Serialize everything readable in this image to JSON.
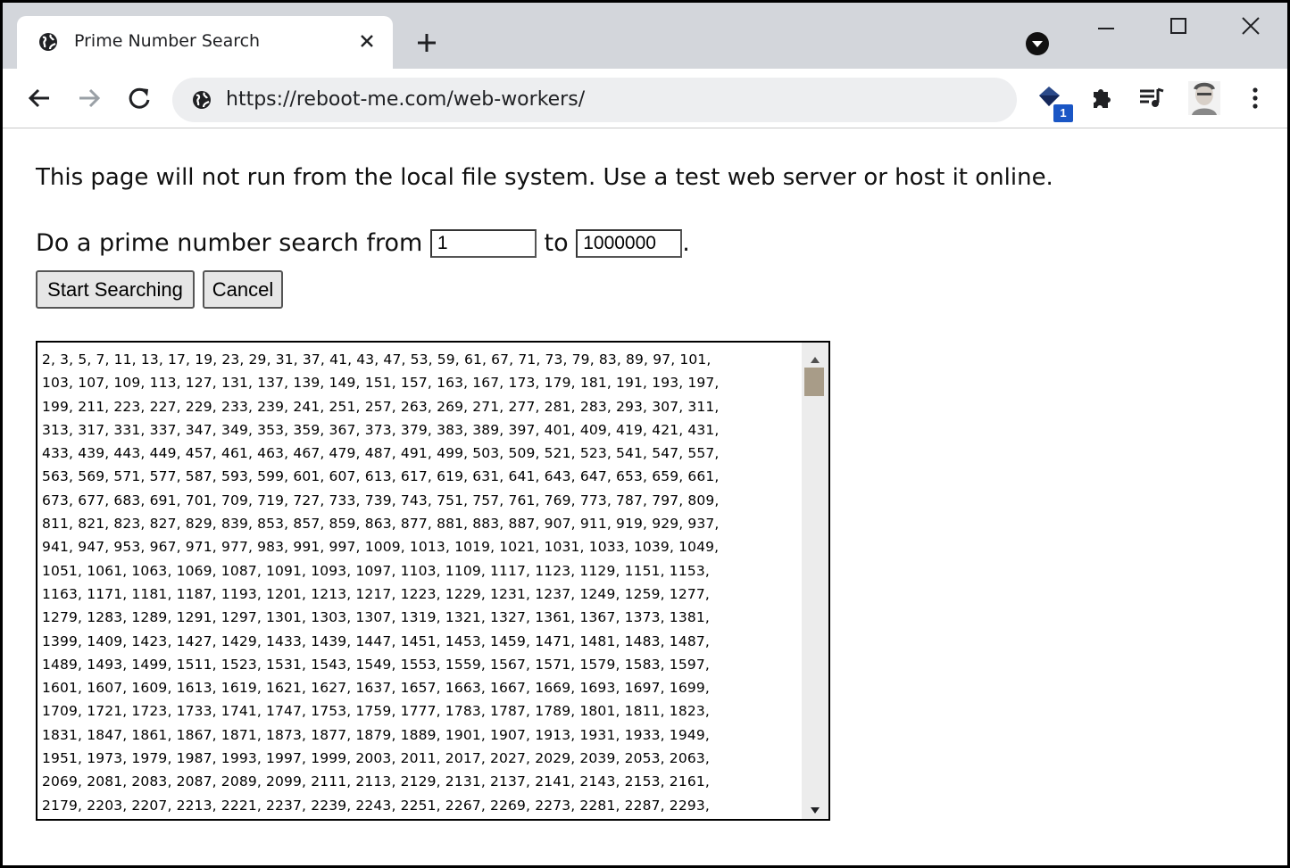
{
  "browser": {
    "tab_title": "Prime Number Search",
    "url": "https://reboot-me.com/web-workers/",
    "extension_badge": "1"
  },
  "page": {
    "notice": "This page will not run from the local file system. Use a test web server or host it online.",
    "search_prefix": "Do a prime number search from",
    "search_to": "to",
    "search_suffix": ".",
    "from_value": "1",
    "to_value": "1000000",
    "start_button": "Start Searching",
    "cancel_button": "Cancel"
  },
  "results": {
    "lines": [
      "2, 3, 5, 7, 11, 13, 17, 19, 23, 29, 31, 37, 41, 43, 47, 53, 59, 61, 67, 71, 73, 79, 83, 89, 97, 101,",
      "103, 107, 109, 113, 127, 131, 137, 139, 149, 151, 157, 163, 167, 173, 179, 181, 191, 193, 197,",
      "199, 211, 223, 227, 229, 233, 239, 241, 251, 257, 263, 269, 271, 277, 281, 283, 293, 307, 311,",
      "313, 317, 331, 337, 347, 349, 353, 359, 367, 373, 379, 383, 389, 397, 401, 409, 419, 421, 431,",
      "433, 439, 443, 449, 457, 461, 463, 467, 479, 487, 491, 499, 503, 509, 521, 523, 541, 547, 557,",
      "563, 569, 571, 577, 587, 593, 599, 601, 607, 613, 617, 619, 631, 641, 643, 647, 653, 659, 661,",
      "673, 677, 683, 691, 701, 709, 719, 727, 733, 739, 743, 751, 757, 761, 769, 773, 787, 797, 809,",
      "811, 821, 823, 827, 829, 839, 853, 857, 859, 863, 877, 881, 883, 887, 907, 911, 919, 929, 937,",
      "941, 947, 953, 967, 971, 977, 983, 991, 997, 1009, 1013, 1019, 1021, 1031, 1033, 1039, 1049,",
      "1051, 1061, 1063, 1069, 1087, 1091, 1093, 1097, 1103, 1109, 1117, 1123, 1129, 1151, 1153,",
      "1163, 1171, 1181, 1187, 1193, 1201, 1213, 1217, 1223, 1229, 1231, 1237, 1249, 1259, 1277,",
      "1279, 1283, 1289, 1291, 1297, 1301, 1303, 1307, 1319, 1321, 1327, 1361, 1367, 1373, 1381,",
      "1399, 1409, 1423, 1427, 1429, 1433, 1439, 1447, 1451, 1453, 1459, 1471, 1481, 1483, 1487,",
      "1489, 1493, 1499, 1511, 1523, 1531, 1543, 1549, 1553, 1559, 1567, 1571, 1579, 1583, 1597,",
      "1601, 1607, 1609, 1613, 1619, 1621, 1627, 1637, 1657, 1663, 1667, 1669, 1693, 1697, 1699,",
      "1709, 1721, 1723, 1733, 1741, 1747, 1753, 1759, 1777, 1783, 1787, 1789, 1801, 1811, 1823,",
      "1831, 1847, 1861, 1867, 1871, 1873, 1877, 1879, 1889, 1901, 1907, 1913, 1931, 1933, 1949,",
      "1951, 1973, 1979, 1987, 1993, 1997, 1999, 2003, 2011, 2017, 2027, 2029, 2039, 2053, 2063,",
      "2069, 2081, 2083, 2087, 2089, 2099, 2111, 2113, 2129, 2131, 2137, 2141, 2143, 2153, 2161,",
      "2179, 2203, 2207, 2213, 2221, 2237, 2239, 2243, 2251, 2267, 2269, 2273, 2281, 2287, 2293,"
    ]
  },
  "icons": {
    "tab_favicon": "globe-icon",
    "tab_close": "close-icon",
    "new_tab": "plus-icon",
    "profile_menu": "chevron-down-circle-icon",
    "back": "arrow-left-icon",
    "forward": "arrow-right-icon",
    "reload": "reload-icon",
    "site_info": "globe-icon",
    "extension_1": "gem-extension-icon",
    "extensions": "puzzle-icon",
    "media": "media-queue-icon",
    "avatar": "avatar",
    "menu": "kebab-menu-icon"
  },
  "colors": {
    "tab_strip": "#d3d6db",
    "omnibox": "#edeef0",
    "badge": "#1a56c5",
    "scroll_thumb": "#a89c88"
  }
}
